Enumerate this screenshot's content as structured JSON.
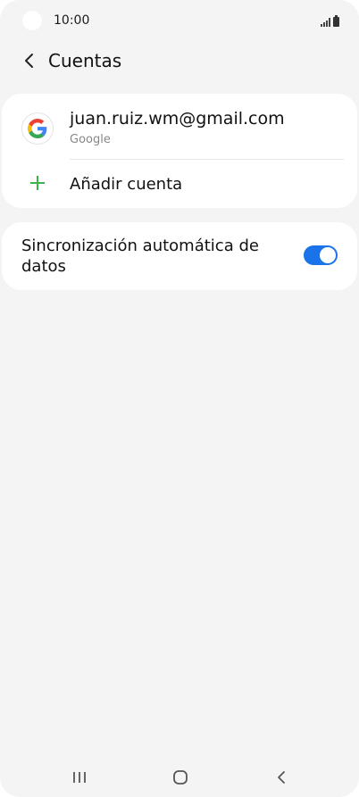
{
  "status_bar": {
    "time": "10:00"
  },
  "header": {
    "title": "Cuentas",
    "back_icon": "chevron-left-icon"
  },
  "accounts": {
    "items": [
      {
        "email": "juan.ruiz.wm@gmail.com",
        "type": "Google",
        "icon": "google-logo-icon"
      }
    ],
    "add_label": "Añadir cuenta",
    "add_icon": "plus-icon"
  },
  "sync": {
    "label": "Sincronización automática de datos",
    "enabled": true
  },
  "colors": {
    "accent": "#1a73e8",
    "add_green": "#3bb54a",
    "background": "#f4f4f4",
    "card": "#ffffff"
  },
  "nav": {
    "icons": [
      "recent-apps-icon",
      "home-icon",
      "back-icon"
    ]
  }
}
